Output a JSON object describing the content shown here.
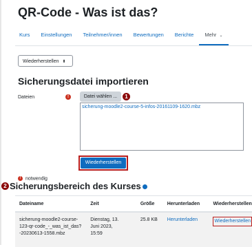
{
  "page": {
    "title": "QR-Code - Was ist das?"
  },
  "nav": {
    "tabs": [
      {
        "label": "Kurs"
      },
      {
        "label": "Einstellungen"
      },
      {
        "label": "Teilnehmer/innen"
      },
      {
        "label": "Bewertungen"
      },
      {
        "label": "Berichte"
      },
      {
        "label": "Mehr",
        "caret": "⌄"
      }
    ]
  },
  "select": {
    "value": "Wiederherstellen",
    "arrow": "⬍"
  },
  "import_section": {
    "heading": "Sicherungsdatei importieren",
    "files_label": "Dateien",
    "required_mark": "!",
    "choose_button": "Datei wählen ...",
    "callout_1": "1",
    "file_name": "sicherung-moodle2-course-5-infos-20161109-1620.mbz",
    "restore_button": "Wiederherstellen"
  },
  "required_note": {
    "mark": "!",
    "text": "notwendig"
  },
  "backup_section": {
    "callout_2": "2",
    "heading": "Sicherungsbereich des Kurses",
    "columns": [
      "Dateiname",
      "Zeit",
      "Größe",
      "Herunterladen",
      "Wiederherstellen"
    ],
    "rows": [
      {
        "filename": [
          "sicherung-moodle2-course-",
          "123-qr-code_-_was_ist_das?",
          "-20230613-1558.mbz"
        ],
        "time": [
          "Dienstag, 13.",
          "Juni 2023,",
          "15:59"
        ],
        "size": "25.8 KB",
        "download": "Herunterladen",
        "restore": "Wiederherstellen"
      }
    ]
  },
  "colors": {
    "accent": "#0f6cbf",
    "callout": "#8b0a0a",
    "highlight_border": "#b81c1c",
    "required": "#ca3120"
  }
}
